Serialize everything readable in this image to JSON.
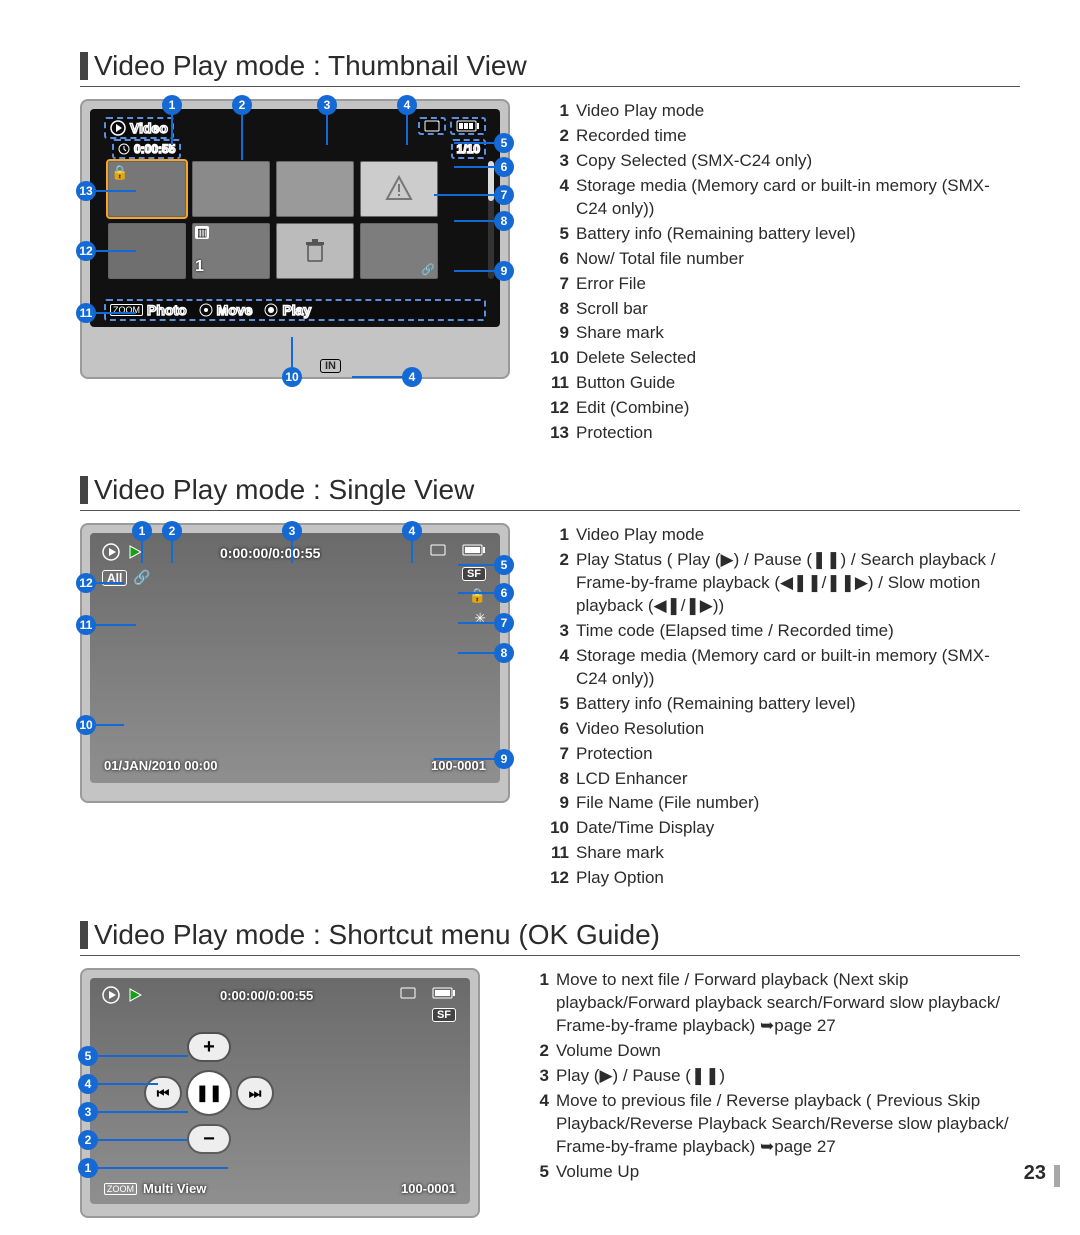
{
  "page_number": "23",
  "sections": {
    "thumb": {
      "title": "Video Play mode : Thumbnail View",
      "legend": [
        "Video Play mode",
        "Recorded time",
        "Copy Selected (SMX-C24 only)",
        "Storage media (Memory card or built-in memory (SMX-C24 only))",
        "Battery info (Remaining battery level)",
        "Now/ Total file number",
        "Error File",
        "Scroll bar",
        "Share mark",
        "Delete Selected",
        "Button Guide",
        "Edit (Combine)",
        "Protection"
      ],
      "osd": {
        "mode_label": "Video",
        "rec_time": "0:00:55",
        "counter": "1/10",
        "btn_photo": "Photo",
        "btn_move": "Move",
        "btn_play": "Play",
        "zoom_label": "ZOOM",
        "in_label": "IN"
      }
    },
    "single": {
      "title": "Video Play mode : Single View",
      "legend_html": [
        "Video Play mode",
        "Play Status ( Play (▶) / Pause (❚❚) / Search playback / Frame-by-frame playback (◀❚❚/❚❚▶) / Slow motion playback (◀❚/❚▶))",
        "Time code (Elapsed time / Recorded time)",
        "Storage media (Memory card or built-in memory (SMX-C24 only))",
        "Battery info (Remaining battery level)",
        "Video Resolution",
        "Protection",
        "LCD Enhancer",
        "File Name (File number)",
        "Date/Time Display",
        "Share mark",
        "Play Option"
      ],
      "osd": {
        "timecode": "0:00:00/0:00:55",
        "play_option": "All",
        "datetime": "01/JAN/2010 00:00",
        "filename": "100-0001",
        "res_label": "SF"
      }
    },
    "shortcut": {
      "title": "Video Play mode : Shortcut menu (OK Guide)",
      "legend": [
        "Move to next file / Forward playback (Next skip playback/Forward playback search/Forward slow playback/ Frame-by-frame playback) ➥page 27",
        "Volume Down",
        "Play (▶) / Pause (❚❚)",
        "Move to previous file / Reverse playback ( Previous Skip Playback/Reverse Playback Search/Reverse slow playback/ Frame-by-frame playback) ➥page 27",
        "Volume Up"
      ],
      "osd": {
        "timecode": "0:00:00/0:00:55",
        "multiview": "Multi View",
        "filename": "100-0001",
        "zoom_label": "ZOOM",
        "res_label": "SF"
      }
    }
  }
}
